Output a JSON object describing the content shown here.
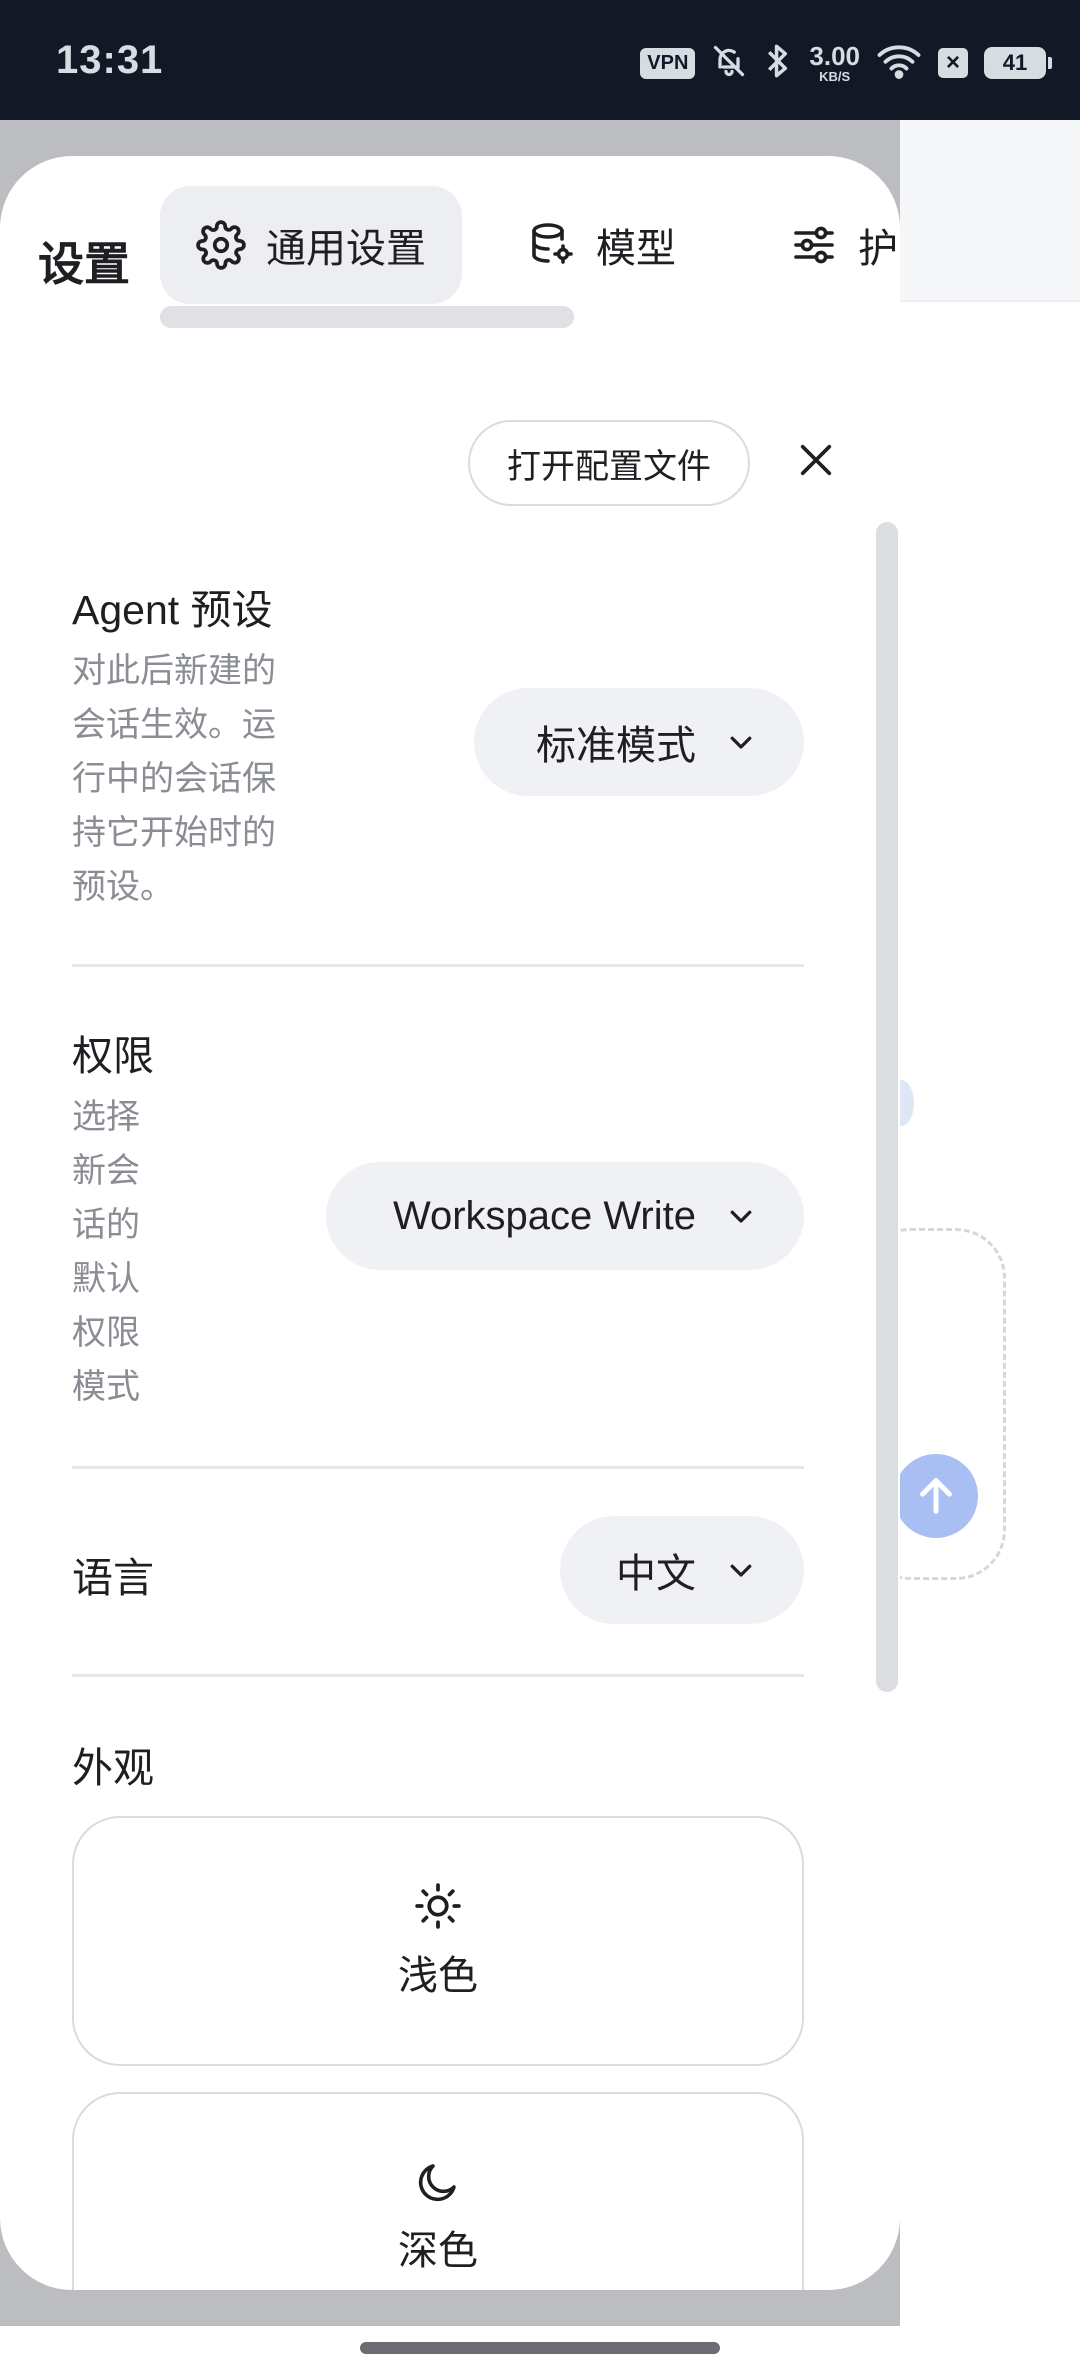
{
  "status_bar": {
    "time": "13:31",
    "vpn": "VPN",
    "net_speed": "3.00",
    "net_unit": "KB/S",
    "battery": "41"
  },
  "sheet": {
    "title": "设置",
    "tabs": [
      {
        "label": "通用设置",
        "icon": "gear-icon",
        "active": true
      },
      {
        "label": "模型",
        "icon": "database-gear-icon",
        "active": false
      },
      {
        "label": "护",
        "icon": "sliders-icon",
        "active": false
      }
    ],
    "open_config_label": "打开配置文件",
    "agent_preset": {
      "title": "Agent 预设",
      "description": [
        "对此后新建的",
        "会话生效。运",
        "行中的会话保",
        "持它开始时的",
        "预设。"
      ],
      "value": "标准模式"
    },
    "permissions": {
      "title": "权限",
      "description": [
        "选择",
        "新会",
        "话的",
        "默认",
        "权限",
        "模式"
      ],
      "value": "Workspace Write"
    },
    "language": {
      "title": "语言",
      "value": "中文"
    },
    "appearance": {
      "title": "外观",
      "options": [
        {
          "label": "浅色",
          "icon": "sun-icon"
        },
        {
          "label": "深色",
          "icon": "moon-icon"
        }
      ]
    }
  },
  "colors": {
    "accent_send": "#a9bff3",
    "status_bar_bg": "#121826",
    "select_bg": "#f0f1f4"
  }
}
